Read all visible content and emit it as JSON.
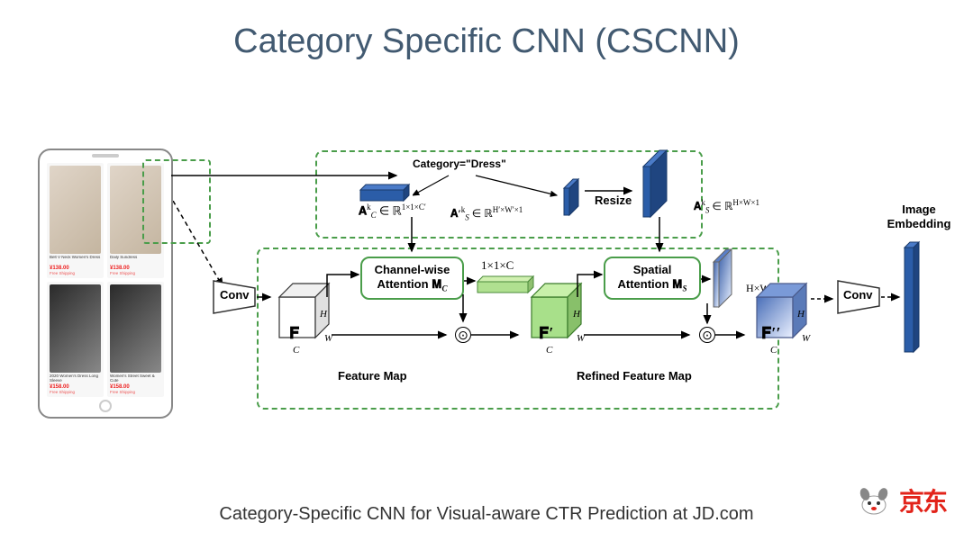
{
  "title": "Category Specific CNN (CSCNN)",
  "caption": "Category-Specific CNN for Visual-aware CTR Prediction at JD.com",
  "logo": {
    "text": "京东",
    "mascot": "joy-dog-icon"
  },
  "phone": {
    "products": [
      {
        "title": "Belt V Neck Women's Dress",
        "price": "¥138.00",
        "ship": "Free Shipping"
      },
      {
        "title": "Daily Sundress",
        "price": "¥138.00",
        "ship": "Free Shipping"
      },
      {
        "title": "2020 Women's Dress Long Sleeve",
        "price": "¥158.00",
        "ship": "Free Shipping"
      },
      {
        "title": "Women's Street Sweet & Cute",
        "price": "¥158.00",
        "ship": "Free Shipping"
      }
    ]
  },
  "conv1": "Conv",
  "conv2": "Conv",
  "category_label": "Category=\"Dress\"",
  "Ack": "𝐀",
  "Ack_sub": "C",
  "Ack_sup": "k",
  "Ack_dim": " ∈ ℝ",
  "Ack_dims": "1×1×C′",
  "Ask_prime": "𝐀′",
  "Ask_sub": "S",
  "Ask_sup": "k",
  "Ask_dims": "H′×W′×1",
  "resize": "Resize",
  "Ask": "𝐀",
  "Ask_dims2": "H×W×1",
  "channel_attn_l1": "Channel-wise",
  "channel_attn_l2": "Attention 𝐌",
  "channel_attn_sub": "C",
  "spatial_attn_l1": "Spatial",
  "spatial_attn_l2": "Attention 𝐌",
  "spatial_attn_sub": "S",
  "F": "𝐅",
  "Fp": "𝐅′",
  "Fpp": "𝐅′′",
  "H": "H",
  "W": "W",
  "C": "C",
  "dim_11C": "1×1×C",
  "dim_HW1": "H×W×1",
  "feature_map": "Feature Map",
  "refined_map": "Refined Feature Map",
  "embedding": "Image\nEmbedding"
}
